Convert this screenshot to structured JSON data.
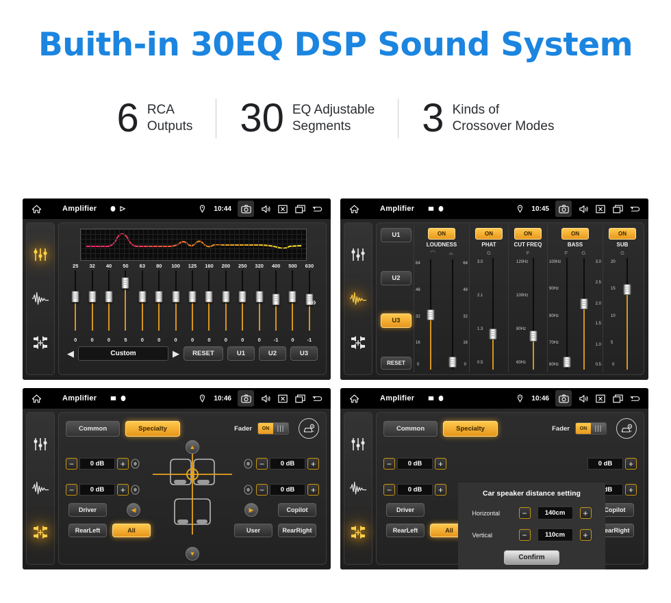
{
  "hero": {
    "title": "Buith-in 30EQ DSP Sound System",
    "accent_color": "#1b85e0"
  },
  "stats": [
    {
      "number": "6",
      "line1": "RCA",
      "line2": "Outputs"
    },
    {
      "number": "30",
      "line1": "EQ Adjustable",
      "line2": "Segments"
    },
    {
      "number": "3",
      "line1": "Kinds of",
      "line2": "Crossover Modes"
    }
  ],
  "colors": {
    "amber": "#e8981c",
    "amber_light": "#ffc94d",
    "panel_bg": "#262626",
    "screen_black": "#000000"
  },
  "devices": {
    "eq": {
      "statusbar": {
        "title": "Amplifier",
        "time": "10:44",
        "icons": [
          "home-icon",
          "record-icon",
          "play-icon",
          "location-icon",
          "camera-icon",
          "volume-icon",
          "close-icon",
          "recents-icon",
          "back-icon"
        ]
      },
      "rail_icons": [
        "eq-sliders-icon",
        "waveform-icon",
        "balance-icon"
      ],
      "rail_active_index": 0,
      "frequencies": [
        "25",
        "32",
        "40",
        "50",
        "63",
        "80",
        "100",
        "125",
        "160",
        "200",
        "250",
        "320",
        "400",
        "500",
        "630"
      ],
      "values": [
        "0",
        "0",
        "0",
        "5",
        "0",
        "0",
        "0",
        "0",
        "0",
        "0",
        "0",
        "0",
        "-1",
        "0",
        "-1"
      ],
      "preset_label": "Custom",
      "prev_label": "◀",
      "next_label": "▶",
      "reset_label": "RESET",
      "user_presets": [
        "U1",
        "U2",
        "U3"
      ],
      "more_label": "»"
    },
    "effects": {
      "statusbar": {
        "title": "Amplifier",
        "time": "10:45"
      },
      "rail_icons": [
        "eq-sliders-icon",
        "waveform-icon",
        "balance-icon"
      ],
      "rail_active_index": 1,
      "presets": [
        "U1",
        "U2",
        "U3"
      ],
      "active_preset": "U3",
      "reset_label": "RESET",
      "columns": [
        {
          "name": "LOUDNESS",
          "toggle": "ON",
          "sub": [
            "⌒",
            "⌓"
          ],
          "sliders": [
            {
              "scale": [
                "64",
                "48",
                "32",
                "16",
                "0"
              ],
              "value_pos": 0.52
            },
            {
              "scale": [
                "64",
                "48",
                "32",
                "16",
                "0"
              ],
              "value_pos": 0.07
            }
          ]
        },
        {
          "name": "PHAT",
          "toggle": "ON",
          "sub": [
            "G"
          ],
          "sliders": [
            {
              "scale": [
                "3.0",
                "2.1",
                "1.3",
                "0.5"
              ],
              "value_pos": 0.32
            }
          ]
        },
        {
          "name": "CUT FREQ",
          "toggle": "ON",
          "sub": [
            "F"
          ],
          "sliders": [
            {
              "scale": [
                "120Hz",
                "100Hz",
                "80Hz",
                "60Hz"
              ],
              "value_pos": 0.3
            }
          ]
        },
        {
          "name": "BASS",
          "toggle": "ON",
          "sub": [
            "F",
            "G"
          ],
          "sliders": [
            {
              "scale": [
                "100Hz",
                "90Hz",
                "80Hz",
                "70Hz",
                "60Hz"
              ],
              "value_pos": 0.06
            },
            {
              "scale": [
                "3.0",
                "2.5",
                "2.0",
                "1.5",
                "1.0",
                "0.5"
              ],
              "value_pos": 0.58
            }
          ]
        },
        {
          "name": "SUB",
          "toggle": "ON",
          "sub": [
            "G"
          ],
          "sliders": [
            {
              "scale": [
                "20",
                "15",
                "10",
                "5",
                "0"
              ],
              "value_pos": 0.72
            }
          ]
        }
      ]
    },
    "fader": {
      "statusbar": {
        "title": "Amplifier",
        "time": "10:46"
      },
      "rail_icons": [
        "eq-sliders-icon",
        "waveform-icon",
        "balance-icon"
      ],
      "rail_active_index": 2,
      "tabs": [
        {
          "label": "Common",
          "active": false
        },
        {
          "label": "Specialty",
          "active": true
        }
      ],
      "fader_label": "Fader",
      "fader_toggle": "ON",
      "car_settings_icon": "car-settings-icon",
      "gain_steppers": [
        {
          "position": "front-left",
          "value": "0 dB",
          "minus": "−",
          "plus": "+"
        },
        {
          "position": "rear-left",
          "value": "0 dB",
          "minus": "−",
          "plus": "+"
        },
        {
          "position": "front-right",
          "value": "0 dB",
          "minus": "−",
          "plus": "+"
        },
        {
          "position": "rear-right",
          "value": "0 dB",
          "minus": "−",
          "plus": "+"
        }
      ],
      "pad_buttons": [
        "▲",
        "◀",
        "▶",
        "▼"
      ],
      "seat_buttons": [
        {
          "label": "Driver",
          "active": false
        },
        {
          "label": "Copilot",
          "active": false
        },
        {
          "label": "RearLeft",
          "active": false
        },
        {
          "label": "All",
          "active": true
        },
        {
          "label": "User",
          "active": false
        },
        {
          "label": "RearRight",
          "active": false
        }
      ]
    },
    "distance": {
      "statusbar": {
        "title": "Amplifier",
        "time": "10:46"
      },
      "dialog": {
        "title": "Car speaker distance setting",
        "rows": [
          {
            "label": "Horizontal",
            "value": "140cm",
            "minus": "−",
            "plus": "+"
          },
          {
            "label": "Vertical",
            "value": "110cm",
            "minus": "−",
            "plus": "+"
          }
        ],
        "confirm_label": "Confirm"
      }
    }
  }
}
